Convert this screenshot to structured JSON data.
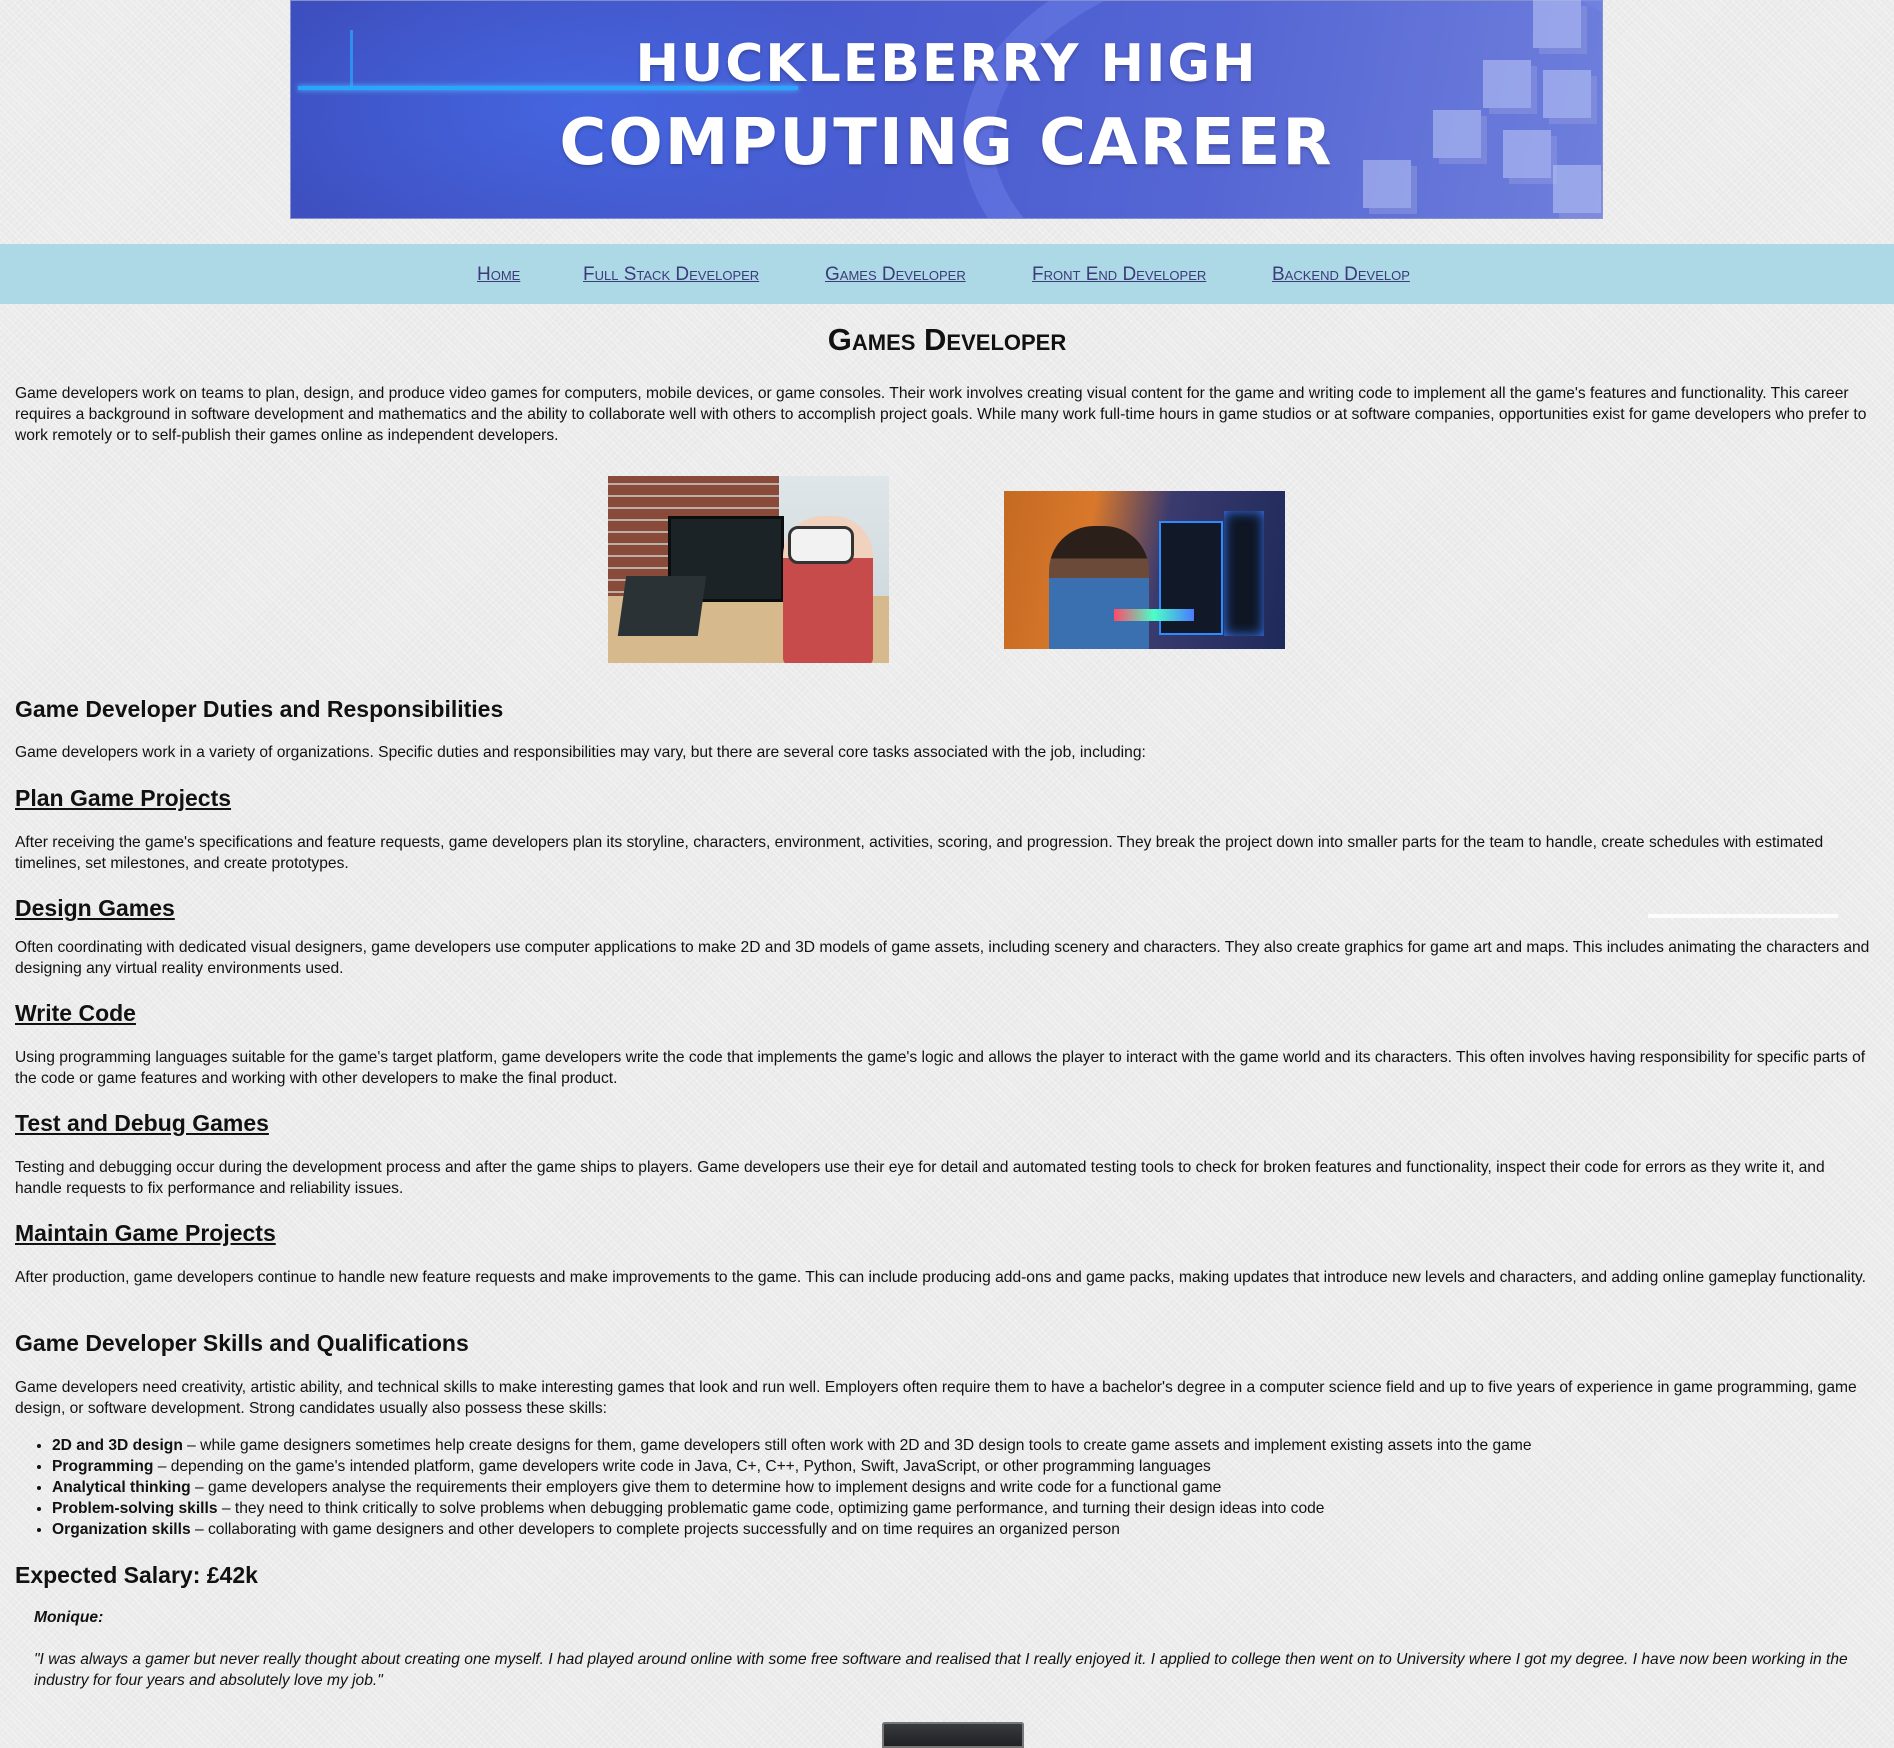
{
  "banner": {
    "line1": "HUCKLEBERRY HIGH",
    "line2": "COMPUTING CAREER"
  },
  "nav": {
    "items": [
      {
        "label": "Home"
      },
      {
        "label": "Full Stack Developer"
      },
      {
        "label": "Games Developer"
      },
      {
        "label": "Front End Developer"
      },
      {
        "label": "Backend Develop"
      }
    ]
  },
  "main": {
    "title": "Games Developer",
    "intro": "Game developers work on teams to plan, design, and produce video games for computers, mobile devices, or game consoles. Their work involves creating visual content for the game and writing code to implement all the game's features and functionality. This career requires a background in software development and mathematics and the ability to collaborate well with others to accomplish project goals. While many work full-time hours in game studios or at software companies, opportunities exist for game developers who prefer to work remotely or to self-publish their games online as independent developers.",
    "duties_heading": "Game Developer Duties and Responsibilities",
    "duties_intro": "Game developers work in a variety of organizations. Specific duties and responsibilities may vary, but there are several core tasks associated with the job, including:",
    "sections": [
      {
        "heading": "Plan Game Projects",
        "text": "After receiving the game's specifications and feature requests, game developers plan its storyline, characters, environment, activities, scoring, and progression. They break the project down into smaller parts for the team to handle, create schedules with estimated timelines, set milestones, and create prototypes."
      },
      {
        "heading": "Design Games",
        "text": "Often coordinating with dedicated visual designers, game developers use computer applications to make 2D and 3D models of game assets, including scenery and characters. They also create graphics for game art and maps. This includes animating the characters and designing any virtual reality environments used."
      },
      {
        "heading": "Write Code",
        "text": "Using programming languages suitable for the game's target platform, game developers write the code that implements the game's logic and allows the player to interact with the game world and its characters. This often involves having responsibility for specific parts of the code or game features and working with other developers to make the final product."
      },
      {
        "heading": "Test and Debug Games",
        "text": "Testing and debugging occur during the development process and after the game ships to players. Game developers use their eye for detail and automated testing tools to check for broken features and functionality, inspect their code for errors as they write it, and handle requests to fix performance and reliability issues."
      },
      {
        "heading": "Maintain Game Projects",
        "text": "After production, game developers continue to handle new feature requests and make improvements to the game. This can include producing add-ons and game packs, making updates that introduce new levels and characters, and adding online gameplay functionality."
      }
    ],
    "skills_heading": "Game Developer Skills and Qualifications",
    "skills_intro": "Game developers need creativity, artistic ability, and technical skills to make interesting games that look and run well. Employers often require them to have a bachelor's degree in a computer science field and up to five years of experience in game programming, game design, or software development. Strong candidates usually also possess these skills:",
    "skills": [
      {
        "name": "2D and 3D design",
        "desc": " – while game designers sometimes help create designs for them, game developers still often work with 2D and 3D design tools to create game assets and implement existing assets into the game"
      },
      {
        "name": "Programming",
        "desc": " – depending on the game's intended platform, game developers write code in Java, C+, C++, Python, Swift, JavaScript, or other programming languages"
      },
      {
        "name": "Analytical thinking",
        "desc": " – game developers analyse the requirements their employers give them to determine how to implement designs and write code for a functional game"
      },
      {
        "name": "Problem-solving skills",
        "desc": " – they need to think critically to solve problems when debugging problematic game code, optimizing game performance, and turning their design ideas into code"
      },
      {
        "name": "Organization skills",
        "desc": " – collaborating with game designers and other developers to complete projects successfully and on time requires an organized person"
      }
    ],
    "salary": "Expected Salary: £42k",
    "testimonial": {
      "name": "Monique:",
      "quote": "\"I was always a gamer but never really thought about creating one myself. I had played around online with some free software and realised that I really enjoyed it. I applied to college then went on to University where I got my degree. I have now been working in the industry for four years and absolutely love my job.\""
    }
  }
}
